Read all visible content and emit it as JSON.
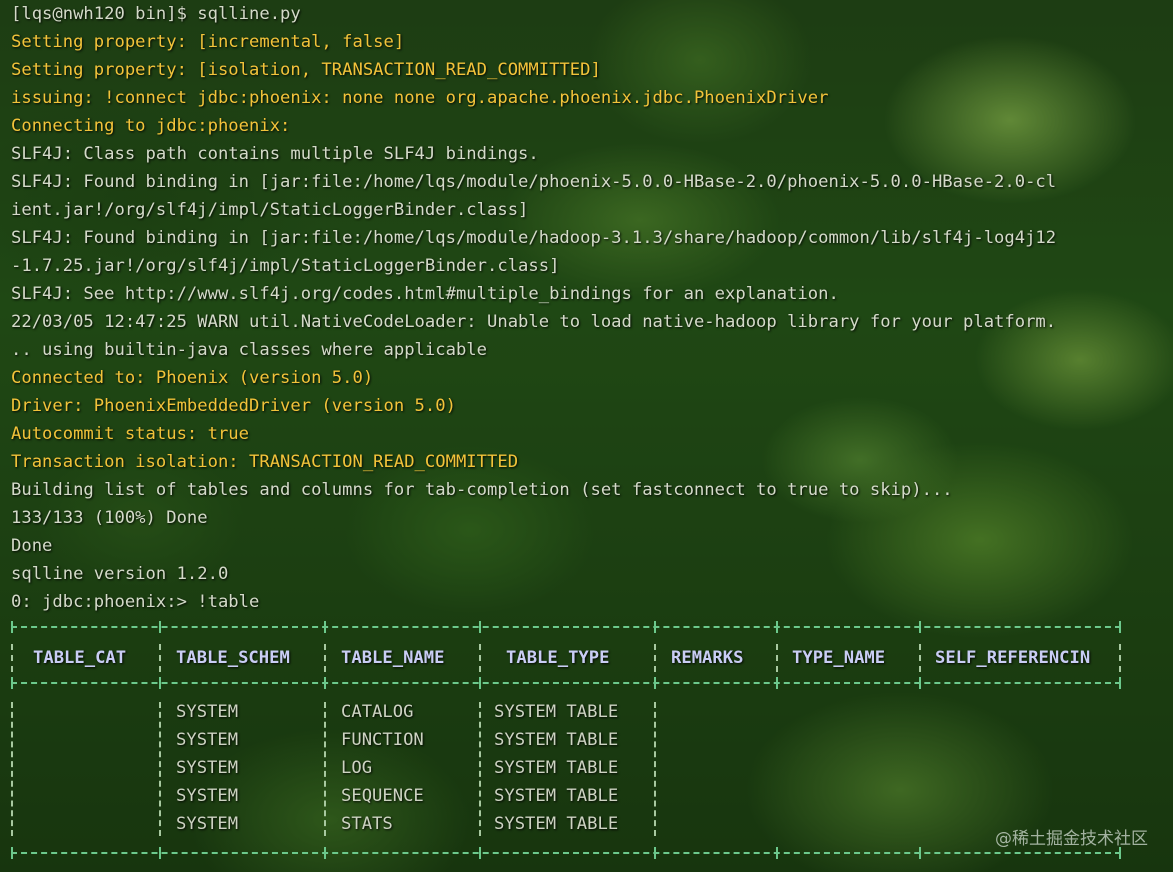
{
  "terminal": {
    "lines": [
      {
        "text": "[lqs@nwh120 bin]$ sqlline.py",
        "color": "white"
      },
      {
        "text": "Setting property: [incremental, false]",
        "color": "yellow"
      },
      {
        "text": "Setting property: [isolation, TRANSACTION_READ_COMMITTED]",
        "color": "yellow"
      },
      {
        "text": "issuing: !connect jdbc:phoenix: none none org.apache.phoenix.jdbc.PhoenixDriver",
        "color": "yellow"
      },
      {
        "text": "Connecting to jdbc:phoenix:",
        "color": "yellow"
      },
      {
        "text": "SLF4J: Class path contains multiple SLF4J bindings.",
        "color": "white"
      },
      {
        "text": "SLF4J: Found binding in [jar:file:/home/lqs/module/phoenix-5.0.0-HBase-2.0/phoenix-5.0.0-HBase-2.0-cl",
        "color": "white"
      },
      {
        "text": "ient.jar!/org/slf4j/impl/StaticLoggerBinder.class]",
        "color": "white"
      },
      {
        "text": "SLF4J: Found binding in [jar:file:/home/lqs/module/hadoop-3.1.3/share/hadoop/common/lib/slf4j-log4j12",
        "color": "white"
      },
      {
        "text": "-1.7.25.jar!/org/slf4j/impl/StaticLoggerBinder.class]",
        "color": "white"
      },
      {
        "text": "SLF4J: See http://www.slf4j.org/codes.html#multiple_bindings for an explanation.",
        "color": "white"
      },
      {
        "text": "22/03/05 12:47:25 WARN util.NativeCodeLoader: Unable to load native-hadoop library for your platform.",
        "color": "white"
      },
      {
        "text": ".. using builtin-java classes where applicable",
        "color": "white"
      },
      {
        "text": "Connected to: Phoenix (version 5.0)",
        "color": "yellow"
      },
      {
        "text": "Driver: PhoenixEmbeddedDriver (version 5.0)",
        "color": "yellow"
      },
      {
        "text": "Autocommit status: true",
        "color": "yellow"
      },
      {
        "text": "Transaction isolation: TRANSACTION_READ_COMMITTED",
        "color": "yellow"
      },
      {
        "text": "Building list of tables and columns for tab-completion (set fastconnect to true to skip)...",
        "color": "white"
      },
      {
        "text": "133/133 (100%) Done",
        "color": "white"
      },
      {
        "text": "Done",
        "color": "white"
      },
      {
        "text": "sqlline version 1.2.0",
        "color": "white"
      },
      {
        "text": "0: jdbc:phoenix:> !table",
        "color": "white"
      }
    ]
  },
  "result_table": {
    "columns": [
      "TABLE_CAT",
      "TABLE_SCHEM",
      "TABLE_NAME",
      "TABLE_TYPE",
      "REMARKS",
      "TYPE_NAME",
      "SELF_REFERENCIN"
    ],
    "rows": [
      [
        "",
        "SYSTEM",
        "CATALOG",
        "SYSTEM TABLE",
        "",
        "",
        ""
      ],
      [
        "",
        "SYSTEM",
        "FUNCTION",
        "SYSTEM TABLE",
        "",
        "",
        ""
      ],
      [
        "",
        "SYSTEM",
        "LOG",
        "SYSTEM TABLE",
        "",
        "",
        ""
      ],
      [
        "",
        "SYSTEM",
        "SEQUENCE",
        "SYSTEM TABLE",
        "",
        "",
        ""
      ],
      [
        "",
        "SYSTEM",
        "STATS",
        "SYSTEM TABLE",
        "",
        "",
        ""
      ]
    ]
  },
  "watermark": "@稀土掘金技术社区",
  "colors": {
    "prompt_text": "#d4dac9",
    "highlight_text": "#f2c33a",
    "header_text": "#c9cdf4",
    "table_rule": "#6cc98c"
  }
}
